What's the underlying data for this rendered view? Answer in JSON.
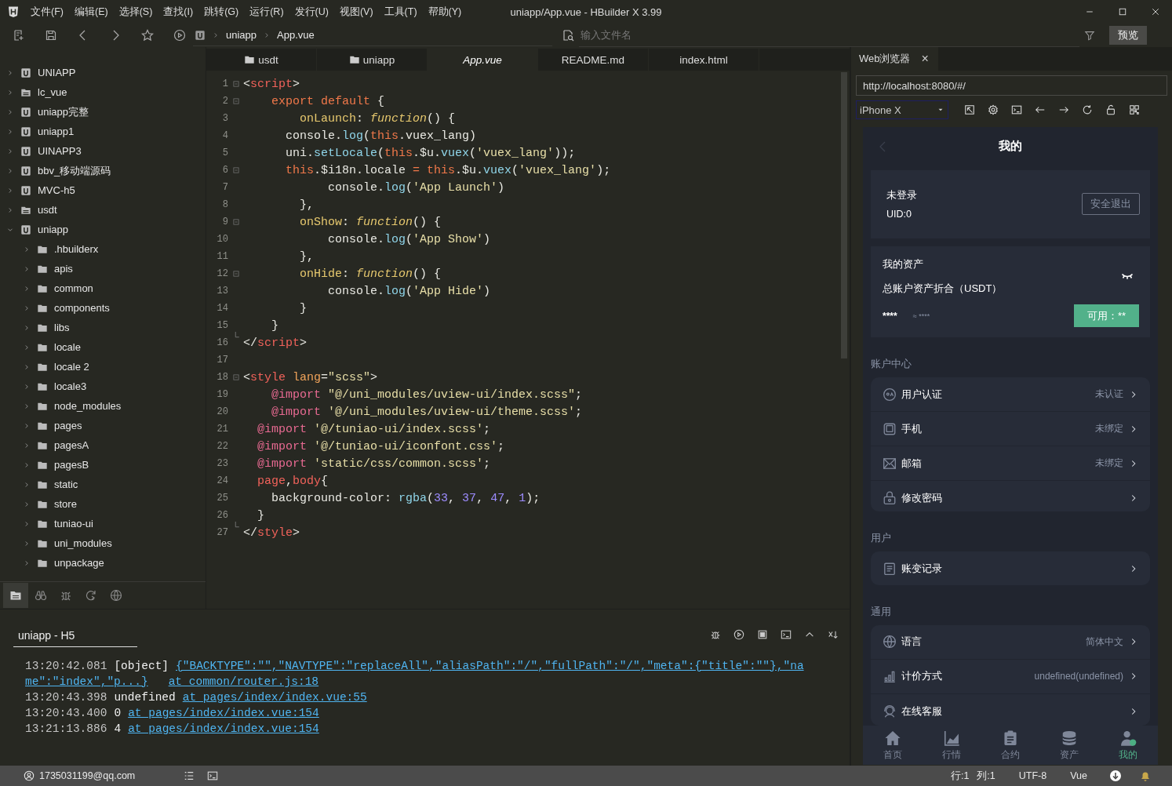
{
  "window": {
    "title": "uniapp/App.vue - HBuilder X 3.99",
    "menu": [
      "文件(F)",
      "编辑(E)",
      "选择(S)",
      "查找(I)",
      "跳转(G)",
      "运行(R)",
      "发行(U)",
      "视图(V)",
      "工具(T)",
      "帮助(Y)"
    ]
  },
  "toolbar": {
    "breadcrumb": [
      "uniapp",
      "App.vue"
    ],
    "search": {
      "placeholder": "输入文件名"
    },
    "preview_button": "预览"
  },
  "sidebar": {
    "tree": [
      {
        "label": "UNIAPP",
        "kind": "project",
        "expanded": false
      },
      {
        "label": "lc_vue",
        "kind": "doc-folder",
        "expanded": false
      },
      {
        "label": "uniapp完整",
        "kind": "project",
        "expanded": false
      },
      {
        "label": "uniapp1",
        "kind": "project",
        "expanded": false
      },
      {
        "label": "UINAPP3",
        "kind": "project",
        "expanded": false
      },
      {
        "label": "bbv_移动端源码",
        "kind": "project",
        "expanded": false
      },
      {
        "label": "MVC-h5",
        "kind": "project",
        "expanded": false
      },
      {
        "label": "usdt",
        "kind": "doc-folder",
        "expanded": false
      },
      {
        "label": "uniapp",
        "kind": "project",
        "expanded": true,
        "children": [
          {
            "label": ".hbuilderx",
            "kind": "folder",
            "expanded": false
          },
          {
            "label": "apis",
            "kind": "folder",
            "expanded": false
          },
          {
            "label": "common",
            "kind": "folder",
            "expanded": false
          },
          {
            "label": "components",
            "kind": "folder",
            "expanded": false
          },
          {
            "label": "libs",
            "kind": "folder",
            "expanded": false
          },
          {
            "label": "locale",
            "kind": "folder",
            "expanded": false
          },
          {
            "label": "locale 2",
            "kind": "folder",
            "expanded": false
          },
          {
            "label": "locale3",
            "kind": "folder",
            "expanded": false
          },
          {
            "label": "node_modules",
            "kind": "folder",
            "expanded": false
          },
          {
            "label": "pages",
            "kind": "folder",
            "expanded": false
          },
          {
            "label": "pagesA",
            "kind": "folder",
            "expanded": false
          },
          {
            "label": "pagesB",
            "kind": "folder",
            "expanded": false
          },
          {
            "label": "static",
            "kind": "folder",
            "expanded": false
          },
          {
            "label": "store",
            "kind": "folder",
            "expanded": false
          },
          {
            "label": "tuniao-ui",
            "kind": "folder",
            "expanded": false
          },
          {
            "label": "uni_modules",
            "kind": "folder",
            "expanded": false
          },
          {
            "label": "unpackage",
            "kind": "folder",
            "expanded": false
          }
        ]
      }
    ],
    "tools": [
      {
        "kind": "files",
        "selected": true
      },
      {
        "kind": "binoculars",
        "selected": false
      },
      {
        "kind": "bug",
        "selected": false
      },
      {
        "kind": "refresh",
        "selected": false
      },
      {
        "kind": "globe",
        "selected": false
      }
    ]
  },
  "editor": {
    "tabs": [
      {
        "label": "usdt",
        "kind": "folder",
        "selected": false
      },
      {
        "label": "uniapp",
        "kind": "folder",
        "selected": false
      },
      {
        "label": "App.vue",
        "kind": "file",
        "selected": true
      },
      {
        "label": "README.md",
        "kind": "file",
        "selected": false
      },
      {
        "label": "index.html",
        "kind": "file",
        "selected": false
      }
    ],
    "lines": [
      {
        "number": "1",
        "kind": "fold-start",
        "tokens": [
          {
            "kind": "plain",
            "text": "<"
          },
          {
            "kind": "tag",
            "text": "script"
          },
          {
            "kind": "plain",
            "text": ">"
          }
        ]
      },
      {
        "number": "2",
        "kind": "fold-start",
        "tokens": [
          {
            "kind": "keyword",
            "text": "    export default"
          },
          {
            "kind": "plain",
            "text": " {"
          }
        ]
      },
      {
        "number": "3",
        "kind": "code",
        "tokens": [
          {
            "kind": "property",
            "text": "        onLaunch"
          },
          {
            "kind": "plain",
            "text": ": "
          },
          {
            "kind": "function",
            "text": "function"
          },
          {
            "kind": "plain",
            "text": "() {"
          }
        ]
      },
      {
        "number": "4",
        "kind": "code",
        "tokens": [
          {
            "kind": "plain",
            "text": "      console."
          },
          {
            "kind": "call",
            "text": "log"
          },
          {
            "kind": "plain",
            "text": "("
          },
          {
            "kind": "keyword",
            "text": "this"
          },
          {
            "kind": "plain",
            "text": ".vuex_lang)"
          }
        ]
      },
      {
        "number": "5",
        "kind": "code",
        "tokens": [
          {
            "kind": "plain",
            "text": "      uni."
          },
          {
            "kind": "call",
            "text": "setLocale"
          },
          {
            "kind": "plain",
            "text": "("
          },
          {
            "kind": "keyword",
            "text": "this"
          },
          {
            "kind": "plain",
            "text": ".$u."
          },
          {
            "kind": "call",
            "text": "vuex"
          },
          {
            "kind": "plain",
            "text": "("
          },
          {
            "kind": "string",
            "text": "'vuex_lang'"
          },
          {
            "kind": "plain",
            "text": "));"
          }
        ]
      },
      {
        "number": "6",
        "kind": "fold-start",
        "tokens": [
          {
            "kind": "keyword",
            "text": "      this"
          },
          {
            "kind": "plain",
            "text": ".$i18n.locale "
          },
          {
            "kind": "keyword",
            "text": "= this"
          },
          {
            "kind": "plain",
            "text": ".$u."
          },
          {
            "kind": "call",
            "text": "vuex"
          },
          {
            "kind": "plain",
            "text": "("
          },
          {
            "kind": "string",
            "text": "'vuex_lang'"
          },
          {
            "kind": "plain",
            "text": ");"
          }
        ]
      },
      {
        "number": "7",
        "kind": "code",
        "tokens": [
          {
            "kind": "plain",
            "text": "            console."
          },
          {
            "kind": "call",
            "text": "log"
          },
          {
            "kind": "plain",
            "text": "("
          },
          {
            "kind": "string",
            "text": "'App Launch'"
          },
          {
            "kind": "plain",
            "text": ")"
          }
        ]
      },
      {
        "number": "8",
        "kind": "code",
        "tokens": [
          {
            "kind": "plain",
            "text": "        },"
          }
        ]
      },
      {
        "number": "9",
        "kind": "fold-start",
        "tokens": [
          {
            "kind": "property",
            "text": "        onShow"
          },
          {
            "kind": "plain",
            "text": ": "
          },
          {
            "kind": "function",
            "text": "function"
          },
          {
            "kind": "plain",
            "text": "() {"
          }
        ]
      },
      {
        "number": "10",
        "kind": "code",
        "tokens": [
          {
            "kind": "plain",
            "text": "            console."
          },
          {
            "kind": "call",
            "text": "log"
          },
          {
            "kind": "plain",
            "text": "("
          },
          {
            "kind": "string",
            "text": "'App Show'"
          },
          {
            "kind": "plain",
            "text": ")"
          }
        ]
      },
      {
        "number": "11",
        "kind": "code",
        "tokens": [
          {
            "kind": "plain",
            "text": "        },"
          }
        ]
      },
      {
        "number": "12",
        "kind": "fold-start",
        "tokens": [
          {
            "kind": "property",
            "text": "        onHide"
          },
          {
            "kind": "plain",
            "text": ": "
          },
          {
            "kind": "function",
            "text": "function"
          },
          {
            "kind": "plain",
            "text": "() {"
          }
        ]
      },
      {
        "number": "13",
        "kind": "code",
        "tokens": [
          {
            "kind": "plain",
            "text": "            console."
          },
          {
            "kind": "call",
            "text": "log"
          },
          {
            "kind": "plain",
            "text": "("
          },
          {
            "kind": "string",
            "text": "'App Hide'"
          },
          {
            "kind": "plain",
            "text": ")"
          }
        ]
      },
      {
        "number": "14",
        "kind": "code",
        "tokens": [
          {
            "kind": "plain",
            "text": "        }"
          }
        ]
      },
      {
        "number": "15",
        "kind": "code",
        "tokens": [
          {
            "kind": "plain",
            "text": "    }"
          }
        ]
      },
      {
        "number": "16",
        "kind": "fold-end",
        "tokens": [
          {
            "kind": "plain",
            "text": "</"
          },
          {
            "kind": "tag",
            "text": "script"
          },
          {
            "kind": "plain",
            "text": ">"
          }
        ]
      },
      {
        "number": "17",
        "kind": "code"
      },
      {
        "number": "18",
        "kind": "fold-start",
        "tokens": [
          {
            "kind": "plain",
            "text": "<"
          },
          {
            "kind": "tag",
            "text": "style"
          },
          {
            "kind": "attribute",
            "text": " lang"
          },
          {
            "kind": "plain",
            "text": "="
          },
          {
            "kind": "string",
            "text": "\"scss\""
          },
          {
            "kind": "plain",
            "text": ">"
          }
        ]
      },
      {
        "number": "19",
        "kind": "code",
        "tokens": [
          {
            "kind": "at-rule",
            "text": "    @import"
          },
          {
            "kind": "string",
            "text": " \"@/uni_modules/uview-ui/index.scss\""
          },
          {
            "kind": "plain",
            "text": ";"
          }
        ]
      },
      {
        "number": "20",
        "kind": "code",
        "tokens": [
          {
            "kind": "at-rule",
            "text": "    @import"
          },
          {
            "kind": "string",
            "text": " '@/uni_modules/uview-ui/theme.scss'"
          },
          {
            "kind": "plain",
            "text": ";"
          }
        ]
      },
      {
        "number": "21",
        "kind": "code",
        "tokens": [
          {
            "kind": "at-rule",
            "text": "  @import"
          },
          {
            "kind": "string",
            "text": " '@/tuniao-ui/index.scss'"
          },
          {
            "kind": "plain",
            "text": ";"
          }
        ]
      },
      {
        "number": "22",
        "kind": "code",
        "tokens": [
          {
            "kind": "at-rule",
            "text": "  @import"
          },
          {
            "kind": "string",
            "text": " '@/tuniao-ui/iconfont.css'"
          },
          {
            "kind": "plain",
            "text": ";"
          }
        ]
      },
      {
        "number": "23",
        "kind": "code",
        "tokens": [
          {
            "kind": "at-rule",
            "text": "  @import"
          },
          {
            "kind": "string",
            "text": " 'static/css/common.scss'"
          },
          {
            "kind": "plain",
            "text": ";"
          }
        ]
      },
      {
        "number": "24",
        "kind": "code",
        "tokens": [
          {
            "kind": "tag",
            "text": "  page"
          },
          {
            "kind": "plain",
            "text": ","
          },
          {
            "kind": "tag",
            "text": "body"
          },
          {
            "kind": "plain",
            "text": "{"
          }
        ]
      },
      {
        "number": "25",
        "kind": "code",
        "tokens": [
          {
            "kind": "plain",
            "text": "    background-color: "
          },
          {
            "kind": "call",
            "text": "rgba"
          },
          {
            "kind": "plain",
            "text": "("
          },
          {
            "kind": "number",
            "text": "33"
          },
          {
            "kind": "plain",
            "text": ", "
          },
          {
            "kind": "number",
            "text": "37"
          },
          {
            "kind": "plain",
            "text": ", "
          },
          {
            "kind": "number",
            "text": "47"
          },
          {
            "kind": "plain",
            "text": ", "
          },
          {
            "kind": "number",
            "text": "1"
          },
          {
            "kind": "plain",
            "text": ");"
          }
        ]
      },
      {
        "number": "26",
        "kind": "code",
        "tokens": [
          {
            "kind": "plain",
            "text": "  }"
          }
        ]
      },
      {
        "number": "27",
        "kind": "fold-end",
        "tokens": [
          {
            "kind": "plain",
            "text": "</"
          },
          {
            "kind": "tag",
            "text": "style"
          },
          {
            "kind": "plain",
            "text": ">"
          }
        ]
      }
    ]
  },
  "console": {
    "tab": "uniapp - H5",
    "logs": [
      {
        "time": "13:20:42.081",
        "message": "[object]",
        "links": [
          "{\"BACKTYPE\":\"\",\"NAVTYPE\":\"replaceAll\",\"aliasPath\":\"/\",\"fullPath\":\"/\",\"meta\":{\"title\":\"\"},\"na",
          "me\":\"index\",\"p...}",
          "at common/router.js:18"
        ]
      },
      {
        "time": "13:20:43.398",
        "message": "undefined",
        "links": [
          "at pages/index/index.vue:55"
        ]
      },
      {
        "time": "13:20:43.400",
        "message": "0",
        "links": [
          "at pages/index/index.vue:154"
        ]
      },
      {
        "time": "13:21:13.886",
        "message": "4",
        "links": [
          "at pages/index/index.vue:154"
        ]
      }
    ]
  },
  "browser": {
    "tab": "Web浏览器",
    "close": "×",
    "url": "http://localhost:8080/#/",
    "device": "iPhone X"
  },
  "app": {
    "title": "我的",
    "user": {
      "name": "未登录",
      "uid": "UID:0",
      "logout": "安全退出"
    },
    "assets": {
      "title": "我的资产",
      "total_label": "总账户资产折合（USDT）",
      "amount": "****",
      "approx": "≈ ****",
      "available": "可用：**"
    },
    "sections": [
      {
        "title": "账户中心",
        "items": [
          {
            "kind": "face",
            "label": "用户认证",
            "value": "未认证"
          },
          {
            "kind": "phone",
            "label": "手机",
            "value": "未绑定"
          },
          {
            "kind": "mail",
            "label": "邮箱",
            "value": "未绑定"
          },
          {
            "kind": "padlock",
            "label": "修改密码"
          }
        ]
      },
      {
        "title": "用户",
        "items": [
          {
            "kind": "clipboard",
            "label": "账变记录"
          }
        ]
      },
      {
        "title": "通用",
        "items": [
          {
            "kind": "globe",
            "label": "语言",
            "value": "简体中文"
          },
          {
            "kind": "bars",
            "label": "计价方式",
            "value": "undefined(undefined)"
          },
          {
            "kind": "headset",
            "label": "在线客服"
          }
        ]
      }
    ],
    "tabbar": [
      {
        "kind": "home",
        "label": "首页",
        "selected": false
      },
      {
        "kind": "chart",
        "label": "行情",
        "selected": false
      },
      {
        "kind": "doc",
        "label": "合约",
        "selected": false
      },
      {
        "kind": "coins",
        "label": "资产",
        "selected": false
      },
      {
        "kind": "person",
        "label": "我的",
        "selected": true
      }
    ]
  },
  "status_bar": {
    "user": "1735031199@qq.com",
    "line": "行:1",
    "column": "列:1",
    "encoding": "UTF-8",
    "language": "Vue"
  }
}
